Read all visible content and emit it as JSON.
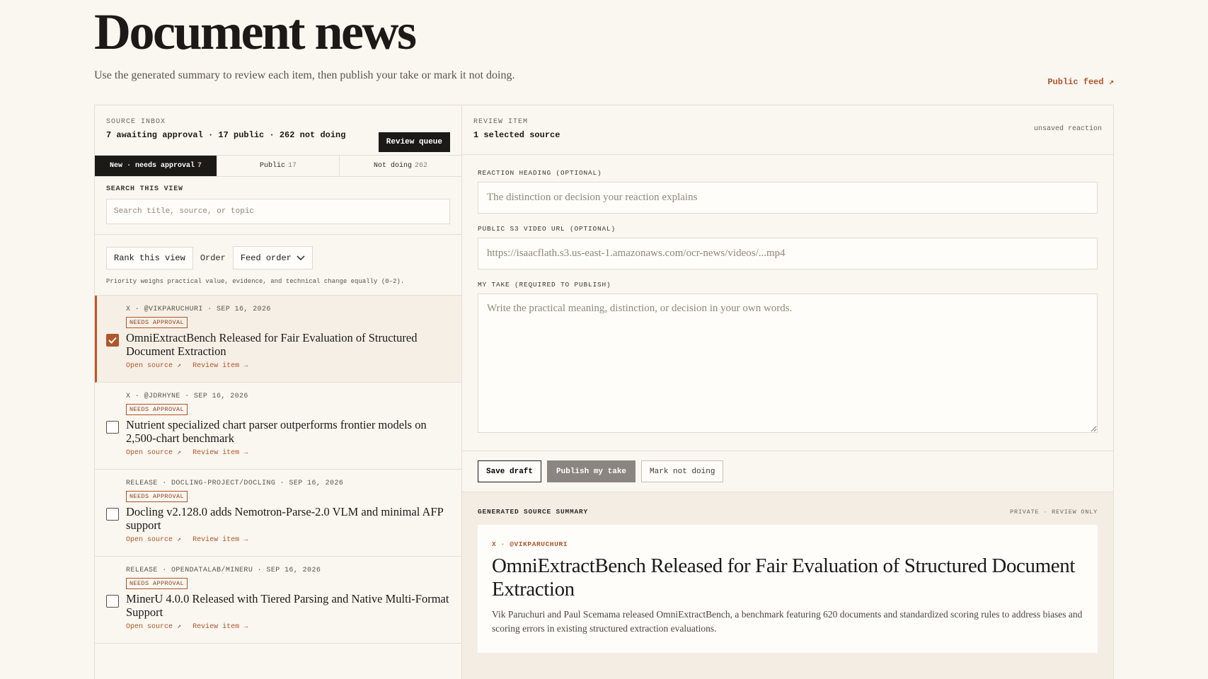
{
  "page": {
    "title": "Document news",
    "subtitle": "Use the generated summary to review each item, then publish your take or mark it not doing.",
    "public_feed": "Public feed ↗"
  },
  "inbox": {
    "eyebrow": "SOURCE INBOX",
    "counts": "7 awaiting approval · 17 public · 262 not doing",
    "review_queue": "Review queue",
    "tabs": [
      {
        "label": "New · needs approval",
        "count": "7",
        "active": true
      },
      {
        "label": "Public",
        "count": "17",
        "active": false
      },
      {
        "label": "Not doing",
        "count": "262",
        "active": false
      }
    ],
    "search_label": "SEARCH THIS VIEW",
    "search_placeholder": "Search title, source, or topic",
    "rank_button": "Rank this view",
    "order_label": "Order",
    "order_value": "Feed order",
    "rank_note": "Priority weighs practical value, evidence, and technical change equally (0–2).",
    "items": [
      {
        "meta": "X · @VIKPARUCHURI · SEP 16, 2026",
        "badge": "NEEDS APPROVAL",
        "title": "OmniExtractBench Released for Fair Evaluation of Structured Document Extraction",
        "open_source": "Open source ↗",
        "review_item": "Review item →",
        "checked": true
      },
      {
        "meta": "X · @JDRHYNE · SEP 16, 2026",
        "badge": "NEEDS APPROVAL",
        "title": "Nutrient specialized chart parser outperforms frontier models on 2,500-chart benchmark",
        "open_source": "Open source ↗",
        "review_item": "Review item →",
        "checked": false
      },
      {
        "meta": "RELEASE · DOCLING-PROJECT/DOCLING · SEP 16, 2026",
        "badge": "NEEDS APPROVAL",
        "title": "Docling v2.128.0 adds Nemotron-Parse-2.0 VLM and minimal AFP support",
        "open_source": "Open source ↗",
        "review_item": "Review item →",
        "checked": false
      },
      {
        "meta": "RELEASE · OPENDATALAB/MINERU · SEP 16, 2026",
        "badge": "NEEDS APPROVAL",
        "title": "MinerU 4.0.0 Released with Tiered Parsing and Native Multi-Format Support",
        "open_source": "Open source ↗",
        "review_item": "Review item →",
        "checked": false
      }
    ]
  },
  "review": {
    "eyebrow": "REVIEW ITEM",
    "selected": "1 selected source",
    "unsaved": "unsaved reaction",
    "heading_label": "REACTION HEADING (OPTIONAL)",
    "heading_placeholder": "The distinction or decision your reaction explains",
    "video_label": "PUBLIC S3 VIDEO URL (OPTIONAL)",
    "video_placeholder": "https://isaacflath.s3.us-east-1.amazonaws.com/ocr-news/videos/...mp4",
    "take_label": "MY TAKE (REQUIRED TO PUBLISH)",
    "take_placeholder": "Write the practical meaning, distinction, or decision in your own words.",
    "save_draft": "Save draft",
    "publish": "Publish my take",
    "not_doing": "Mark not doing"
  },
  "summary": {
    "label": "GENERATED SOURCE SUMMARY",
    "note": "PRIVATE · REVIEW ONLY",
    "source": "X · @VIKPARUCHURI",
    "title": "OmniExtractBench Released for Fair Evaluation of Structured Document Extraction",
    "body": "Vik Paruchuri and Paul Scemama released OmniExtractBench, a benchmark featuring 620 documents and standardized scoring rules to address biases and scoring errors in existing structured extraction evaluations."
  },
  "colors": {
    "accent": "#b0562a",
    "background": "#faf6f0",
    "dark": "#1c1a17"
  },
  "icons": {
    "checkbox_checked": "check-icon",
    "select_arrow": "chevron-down-icon"
  }
}
